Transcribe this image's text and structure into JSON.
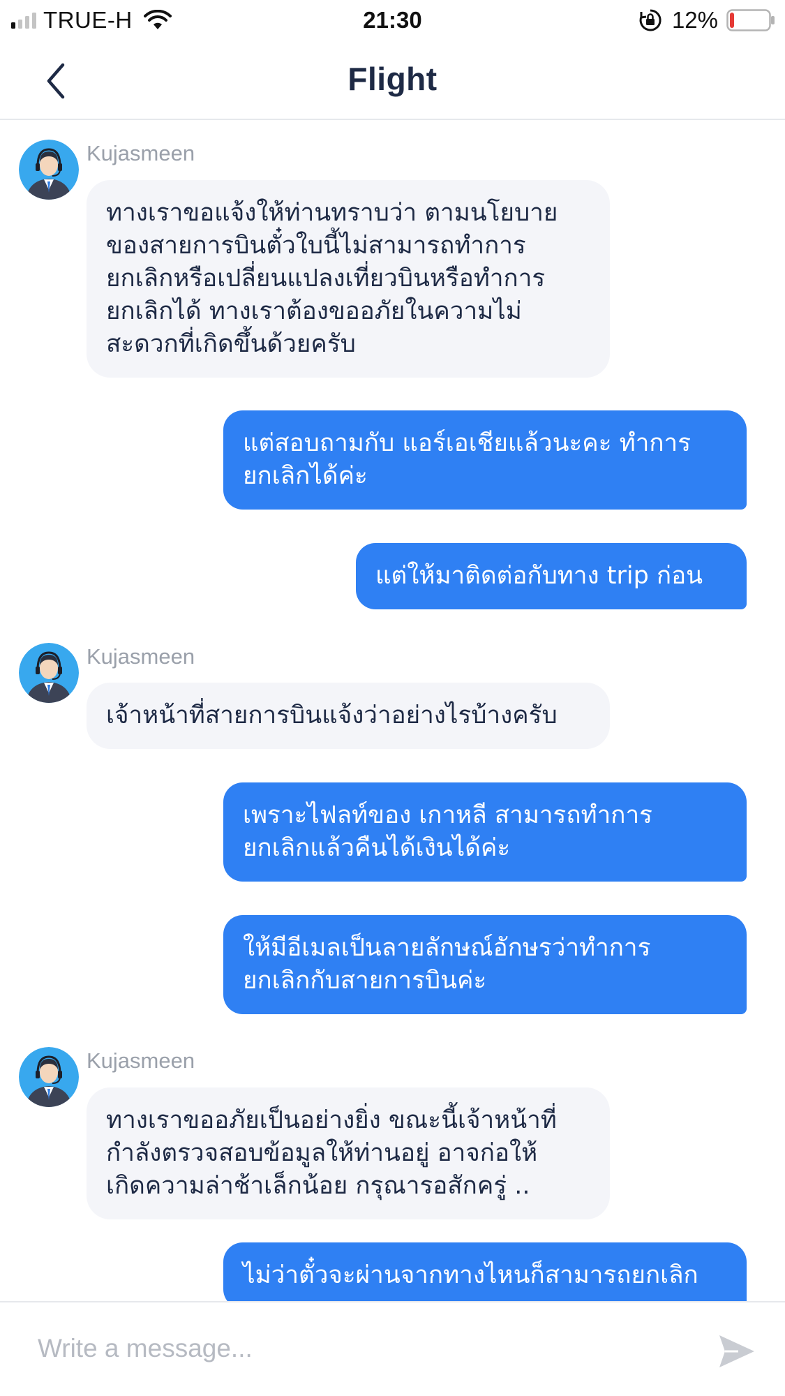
{
  "status_bar": {
    "carrier": "TRUE-H",
    "time": "21:30",
    "battery_percent": "12%",
    "signal_bars_active": 1,
    "signal_bars_total": 4,
    "battery_level": 0.12,
    "battery_color": "#e53935"
  },
  "header": {
    "title": "Flight",
    "back_icon": "chevron-left-icon"
  },
  "messages": [
    {
      "sender": "Kujasmeen",
      "direction": "incoming",
      "lines": [
        "ทางเราขอแจ้งให้ท่านทราบว่า ตามนโยบาย",
        "ของสายการบินตั๋วใบนี้ไม่สามารถทำการ",
        "ยกเลิกหรือเปลี่ยนแปลงเที่ยวบินหรือทำการ",
        "ยกเลิกได้ ทางเราต้องขออภัยในความไม่",
        "สะดวกที่เกิดขึ้นด้วยครับ"
      ]
    },
    {
      "direction": "outgoing",
      "lines": [
        "แต่สอบถามกับ แอร์เอเชียแล้วนะคะ ทำการ",
        "ยกเลิกได้ค่ะ"
      ]
    },
    {
      "direction": "outgoing",
      "lines": [
        "แต่ให้มาติดต่อกับทาง trip ก่อน"
      ]
    },
    {
      "sender": "Kujasmeen",
      "direction": "incoming",
      "lines": [
        "เจ้าหน้าที่สายการบินแจ้งว่าอย่างไรบ้างครับ"
      ]
    },
    {
      "direction": "outgoing",
      "lines": [
        "เพราะไฟลท์ของ เกาหลี สามารถทำการ",
        "ยกเลิกแล้วคืนได้เงินได้ค่ะ"
      ]
    },
    {
      "direction": "outgoing",
      "lines": [
        "ให้มีอีเมลเป็นลายลักษณ์อักษรว่าทำการ",
        "ยกเลิกกับสายการบินค่ะ"
      ]
    },
    {
      "sender": "Kujasmeen",
      "direction": "incoming",
      "lines": [
        "ทางเราขออภัยเป็นอย่างยิ่ง ขณะนี้เจ้าหน้าที่",
        "กำลังตรวจสอบข้อมูลให้ท่านอยู่ อาจก่อให้",
        "เกิดความล่าช้าเล็กน้อย กรุณารอสักครู่ .."
      ]
    },
    {
      "direction": "outgoing",
      "lines": [
        "ไม่ว่าตั๋วจะผ่านจากทางไหนก็สามารถยกเลิก"
      ]
    }
  ],
  "composer": {
    "placeholder": "Write a message...",
    "send_icon": "send-icon"
  },
  "colors": {
    "outgoing_bubble": "#2f80f3",
    "incoming_bubble": "#f4f5f9",
    "title_text": "#1e2a45",
    "sender_name": "#9aa0aa"
  }
}
